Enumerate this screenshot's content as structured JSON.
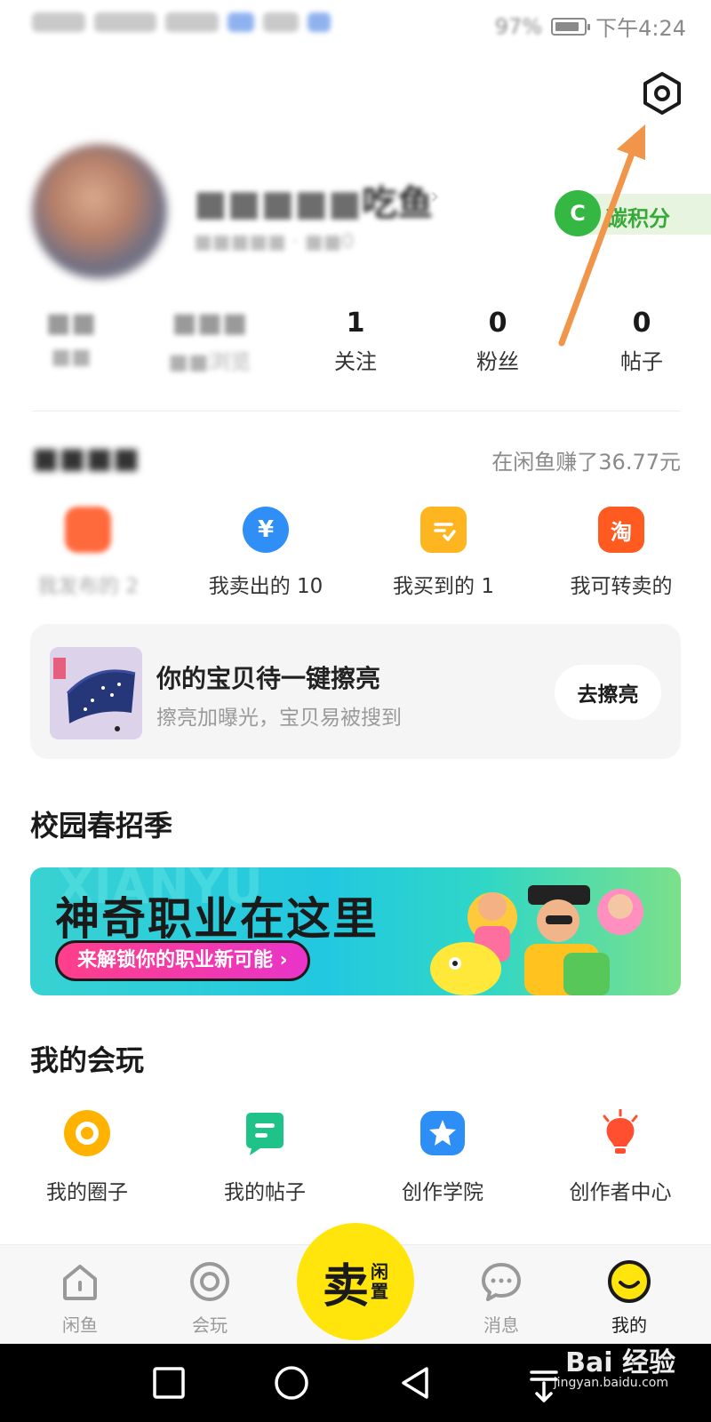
{
  "status_bar": {
    "battery": "97%",
    "time": "下午4:24"
  },
  "profile": {
    "username": "吃鱼",
    "user_id": "0",
    "carbon_badge": {
      "icon_letter": "C",
      "label": "碳积分"
    },
    "stats": [
      {
        "value": "",
        "label": ""
      },
      {
        "value": "",
        "label": "浏览"
      },
      {
        "value": "1",
        "label": "关注"
      },
      {
        "value": "0",
        "label": "粉丝"
      },
      {
        "value": "0",
        "label": "帖子"
      }
    ]
  },
  "trade": {
    "earned": "在闲鱼赚了36.77元",
    "items": [
      {
        "label": "我发布的 2",
        "icon": "published-icon",
        "color": "#ff6a3d"
      },
      {
        "label": "我卖出的 10",
        "icon": "yen-icon",
        "color": "#2f8ff7",
        "glyph": "¥"
      },
      {
        "label": "我买到的 1",
        "icon": "check-list-icon",
        "color": "#ffb51f"
      },
      {
        "label": "我可转卖的",
        "icon": "taobao-icon",
        "color": "#ff5a1f",
        "glyph": "淘"
      }
    ]
  },
  "polish_card": {
    "title": "你的宝贝待一键擦亮",
    "subtitle": "擦亮加曝光，宝贝易被搜到",
    "button": "去擦亮"
  },
  "campus": {
    "heading": "校园春招季",
    "banner_title": "神奇职业在这里",
    "banner_cta": "来解锁你的职业新可能 ›"
  },
  "play": {
    "heading": "我的会玩",
    "items": [
      {
        "label": "我的圈子",
        "icon": "circle-icon",
        "color": "#ffb300"
      },
      {
        "label": "我的帖子",
        "icon": "post-icon",
        "color": "#1fc38a"
      },
      {
        "label": "创作学院",
        "icon": "star-icon",
        "color": "#2d8ef5"
      },
      {
        "label": "创作者中心",
        "icon": "bulb-icon",
        "color": "#ff4e30"
      }
    ]
  },
  "bottom_nav": {
    "items": [
      {
        "label": "闲鱼",
        "icon": "home-icon"
      },
      {
        "label": "会玩",
        "icon": "target-icon"
      },
      {
        "label": "消息",
        "icon": "chat-icon"
      },
      {
        "label": "我的",
        "icon": "smile-icon"
      }
    ],
    "sell": {
      "main": "卖",
      "sub_1": "闲",
      "sub_2": "置"
    },
    "active": "我的"
  },
  "watermark": {
    "brand": "Bai 经验",
    "url": "jingyan.baidu.com"
  },
  "colors": {
    "accent_yellow": "#ffe50c",
    "annotation_arrow": "#f0954a",
    "carbon_green": "#35b843"
  }
}
